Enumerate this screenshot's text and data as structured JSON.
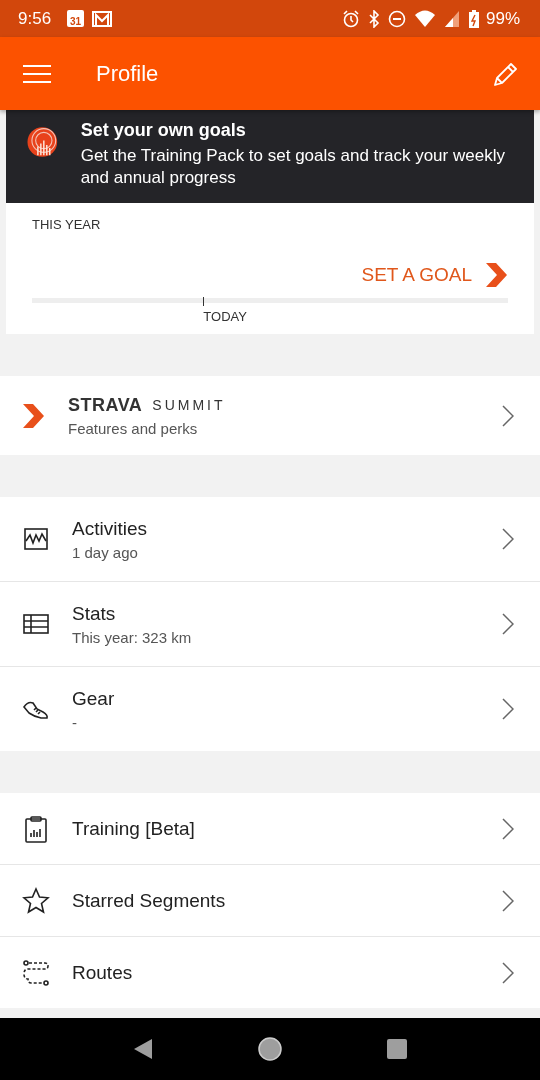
{
  "status_bar": {
    "time": "9:56",
    "calendar_day": "31",
    "battery": "99%"
  },
  "app_bar": {
    "title": "Profile"
  },
  "promo": {
    "title": "Set your own goals",
    "text": "Get the Training Pack to set goals and track your weekly and annual progress"
  },
  "goal_card": {
    "period": "THIS YEAR",
    "action": "SET A GOAL",
    "today_label": "TODAY",
    "level": 0.36
  },
  "summit": {
    "brand": "STRAVA",
    "product": "SUMMIT",
    "subtitle": "Features and perks"
  },
  "menu_groups": [
    [
      {
        "kind": "activity",
        "title": "Activities",
        "subtitle": "1 day ago"
      },
      {
        "kind": "stats",
        "title": "Stats",
        "subtitle": "This year: 323 km"
      },
      {
        "kind": "gear",
        "title": "Gear",
        "subtitle": "-"
      }
    ],
    [
      {
        "kind": "training",
        "title": "Training [Beta]"
      },
      {
        "kind": "star",
        "title": "Starred Segments"
      },
      {
        "kind": "routes",
        "title": "Routes"
      }
    ]
  ]
}
